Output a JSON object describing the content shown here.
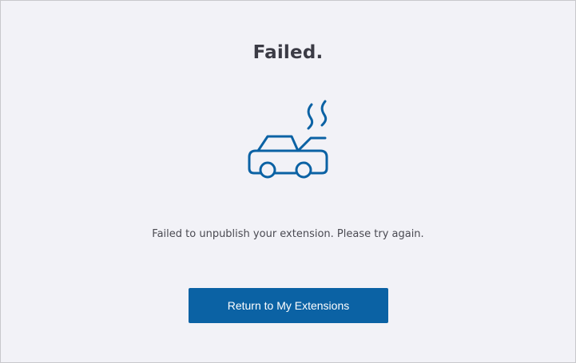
{
  "dialog": {
    "title": "Failed.",
    "illustration_icon": "broken-down-car-icon",
    "message": "Failed to unpublish your extension. Please try again.",
    "return_button_label": "Return to My Extensions"
  },
  "colors": {
    "background": "#f2f2f7",
    "accent": "#0b62a4",
    "title_text": "#3b3b45",
    "body_text": "#4a4a52",
    "button_text": "#ffffff"
  }
}
